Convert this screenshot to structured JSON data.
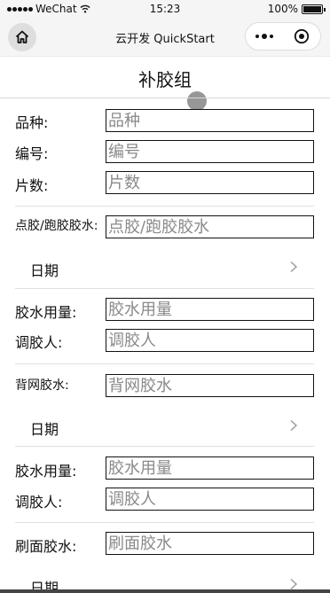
{
  "status_bar": {
    "carrier": "WeChat",
    "time": "15:23",
    "battery": "100%",
    "battery_level": 1.0
  },
  "nav": {
    "title": "云开发 QuickStart"
  },
  "page": {
    "title": "补胶组"
  },
  "form": {
    "variety": {
      "label": "品种:",
      "placeholder": "品种"
    },
    "code": {
      "label": "编号:",
      "placeholder": "编号"
    },
    "count": {
      "label": "片数:",
      "placeholder": "片数"
    },
    "dispense_glue": {
      "label": "点胶/跑胶胶水:",
      "placeholder": "点胶/跑胶胶水"
    },
    "date1": {
      "label": "日期"
    },
    "glue_amount1": {
      "label": "胶水用量:",
      "placeholder": "胶水用量"
    },
    "mixer1": {
      "label": "调胶人:",
      "placeholder": "调胶人"
    },
    "back_mesh_glue": {
      "label": "背网胶水:",
      "placeholder": "背网胶水"
    },
    "date2": {
      "label": "日期"
    },
    "glue_amount2": {
      "label": "胶水用量:",
      "placeholder": "胶水用量"
    },
    "mixer2": {
      "label": "调胶人:",
      "placeholder": "调胶人"
    },
    "brush_glue": {
      "label": "刷面胶水:",
      "placeholder": "刷面胶水"
    },
    "date3": {
      "label": "日期"
    }
  },
  "icons": {
    "home": "home-icon",
    "more": "more-dots-icon",
    "close": "target-close-icon",
    "chevron": "chevron-right-icon",
    "wifi": "wifi-icon",
    "battery": "battery-icon"
  }
}
